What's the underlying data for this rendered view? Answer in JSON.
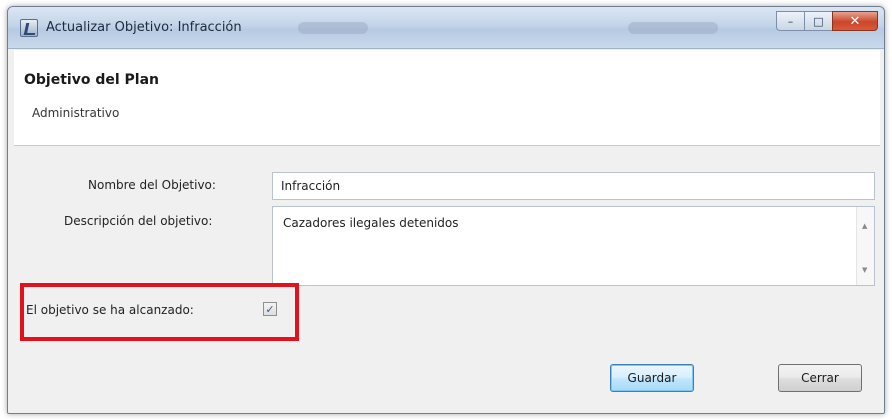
{
  "window": {
    "title": "Actualizar Objetivo: Infracción",
    "minimize_glyph": "–",
    "maximize_glyph": "□",
    "close_glyph": "✕"
  },
  "header": {
    "title": "Objetivo del Plan",
    "subtitle": "Administrativo"
  },
  "form": {
    "name_label": "Nombre del Objetivo:",
    "name_value": "Infracción",
    "description_label": "Descripción del objetivo:",
    "description_value": "Cazadores ilegales detenidos",
    "achieved_label": "El objetivo se ha alcanzado:",
    "achieved_checked": true,
    "check_glyph": "✓",
    "scroll_up_glyph": "▲",
    "scroll_down_glyph": "▼"
  },
  "buttons": {
    "save_label": "Guardar",
    "close_label": "Cerrar"
  },
  "colors": {
    "highlight": "#e3121a",
    "default_button_border": "#3c7fb1"
  }
}
